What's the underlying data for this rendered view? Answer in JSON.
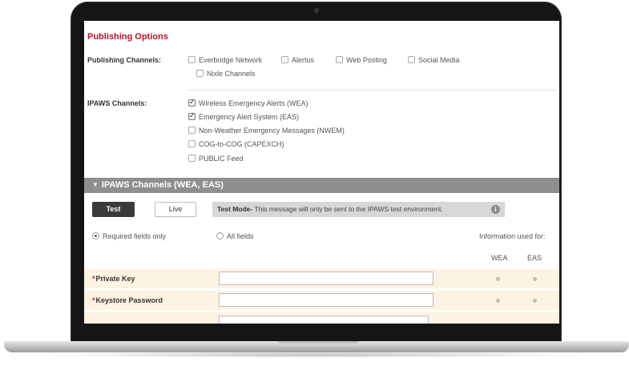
{
  "publishing": {
    "title": "Publishing Options",
    "channels_label": "Publishing Channels:",
    "channels": [
      {
        "label": "Everbridge Network",
        "checked": false
      },
      {
        "label": "Alertus",
        "checked": false
      },
      {
        "label": "Web Posting",
        "checked": false
      },
      {
        "label": "Social Media",
        "checked": false
      },
      {
        "label": "Nixle Channels",
        "checked": false
      }
    ],
    "ipaws_label": "IPAWS Channels:",
    "ipaws_channels": [
      {
        "label": "Wireless Emergency Alerts (WEA)",
        "checked": true
      },
      {
        "label": "Emergency Alert System (EAS)",
        "checked": true
      },
      {
        "label": "Non-Weather Emergency Messages (NWEM)",
        "checked": false
      },
      {
        "label": "COG-to-COG (CAPEXCH)",
        "checked": false
      },
      {
        "label": "PUBLIC Feed",
        "checked": false
      }
    ]
  },
  "ipaws_panel": {
    "header": "IPAWS Channels (WEA, EAS)",
    "test_label": "Test",
    "live_label": "Live",
    "banner_bold": "Test Mode-",
    "banner_text": " This message will only be sent to the IPAWS test environment.",
    "radio_required": "Required fields only",
    "radio_all": "All fields",
    "info_used_for": "Information used for:",
    "col_wea": "WEA",
    "col_eas": "EAS",
    "fields": [
      {
        "label": "Private Key",
        "value": ""
      },
      {
        "label": "Keystore Password",
        "value": ""
      }
    ],
    "colors": {
      "accent": "#b5122b",
      "header_bg": "#8e8e8e",
      "row_bg": "#fdf3e3"
    }
  }
}
